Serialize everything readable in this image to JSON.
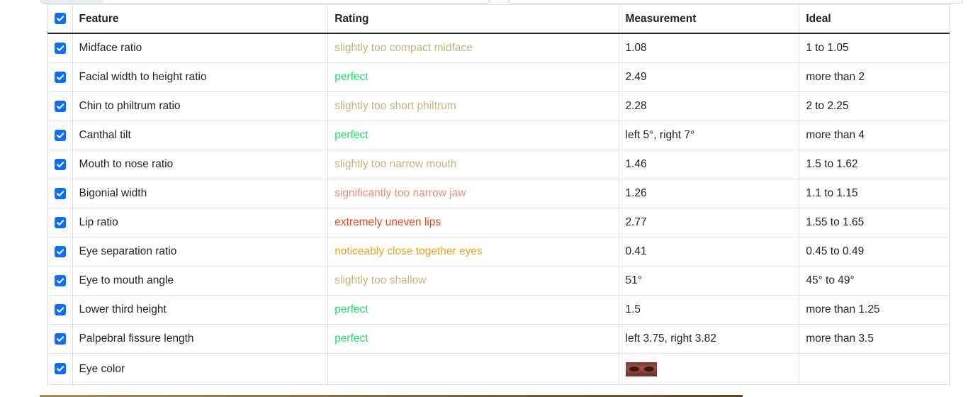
{
  "table": {
    "headers": {
      "feature": "Feature",
      "rating": "Rating",
      "measurement": "Measurement",
      "ideal": "Ideal"
    },
    "header_checked": true,
    "rows": [
      {
        "checked": true,
        "feature": "Midface ratio",
        "rating": "slightly too compact midface",
        "rating_color": "#c2b47e",
        "measurement": "1.08",
        "ideal": "1 to 1.05"
      },
      {
        "checked": true,
        "feature": "Facial width to height ratio",
        "rating": "perfect",
        "rating_color": "#22dd66",
        "measurement": "2.49",
        "ideal": "more than 2"
      },
      {
        "checked": true,
        "feature": "Chin to philtrum ratio",
        "rating": "slightly too short philtrum",
        "rating_color": "#c2b47e",
        "measurement": "2.28",
        "ideal": "2 to 2.25"
      },
      {
        "checked": true,
        "feature": "Canthal tilt",
        "rating": "perfect",
        "rating_color": "#22dd66",
        "measurement": "left 5°, right 7°",
        "ideal": "more than 4"
      },
      {
        "checked": true,
        "feature": "Mouth to nose ratio",
        "rating": "slightly too narrow mouth",
        "rating_color": "#c2b47e",
        "measurement": "1.46",
        "ideal": "1.5 to 1.62"
      },
      {
        "checked": true,
        "feature": "Bigonial width",
        "rating": "significantly too narrow jaw",
        "rating_color": "#e8907a",
        "measurement": "1.26",
        "ideal": "1.1 to 1.15"
      },
      {
        "checked": true,
        "feature": "Lip ratio",
        "rating": "extremely uneven lips",
        "rating_color": "#e64a19",
        "measurement": "2.77",
        "ideal": "1.55 to 1.65"
      },
      {
        "checked": true,
        "feature": "Eye separation ratio",
        "rating": "noticeably close together eyes",
        "rating_color": "#f0a020",
        "measurement": "0.41",
        "ideal": "0.45 to 0.49"
      },
      {
        "checked": true,
        "feature": "Eye to mouth angle",
        "rating": "slightly too shallow",
        "rating_color": "#c2b47e",
        "measurement": "51°",
        "ideal": "45° to 49°"
      },
      {
        "checked": true,
        "feature": "Lower third height",
        "rating": "perfect",
        "rating_color": "#22dd66",
        "measurement": "1.5",
        "ideal": "more than 1.25"
      },
      {
        "checked": true,
        "feature": "Palpebral fissure length",
        "rating": "perfect",
        "rating_color": "#22dd66",
        "measurement": "left 3.75, right 3.82",
        "ideal": "more than 3.5"
      },
      {
        "checked": true,
        "feature": "Eye color",
        "rating": "",
        "rating_color": "#c2b47e",
        "measurement": "",
        "measurement_image": "eye-color-swatch",
        "ideal": ""
      }
    ]
  },
  "colors": {
    "accent": "#0d6efd",
    "border": "#dee2e6"
  }
}
